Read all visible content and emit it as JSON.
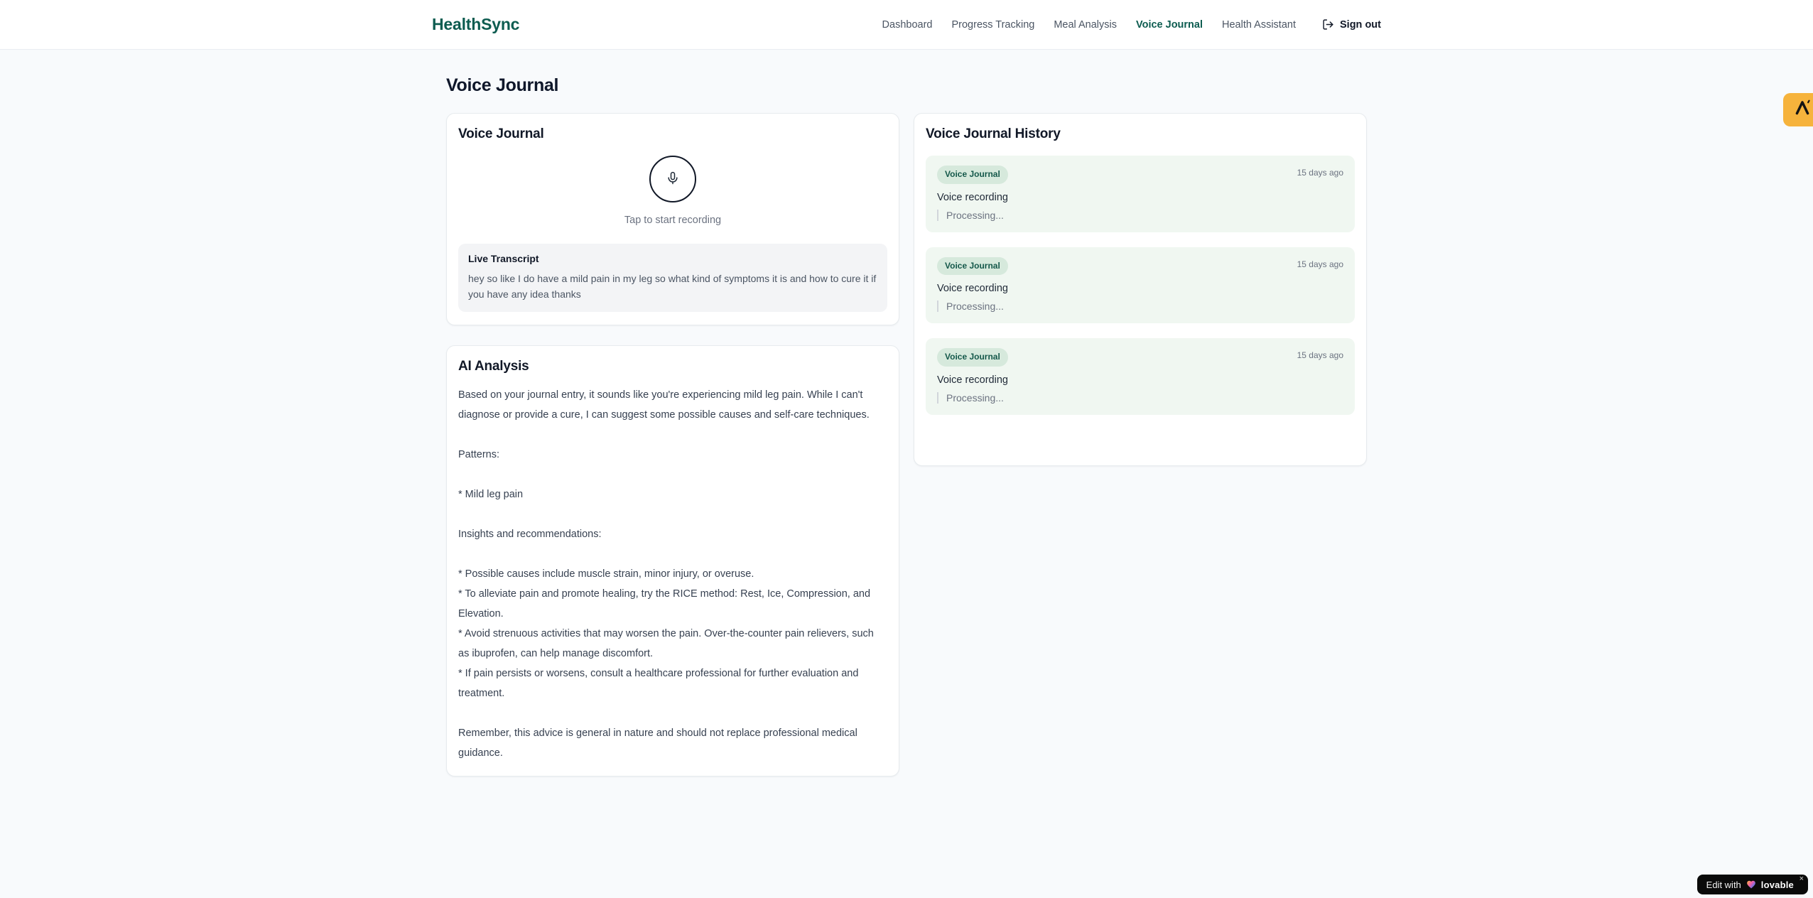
{
  "brand": {
    "name": "HealthSync",
    "color": "#0d5c50"
  },
  "nav": {
    "items": [
      {
        "label": "Dashboard",
        "active": false
      },
      {
        "label": "Progress Tracking",
        "active": false
      },
      {
        "label": "Meal Analysis",
        "active": false
      },
      {
        "label": "Voice Journal",
        "active": true
      },
      {
        "label": "Health Assistant",
        "active": false
      }
    ],
    "signout": {
      "label": "Sign out",
      "icon": "logout-icon"
    }
  },
  "page": {
    "title": "Voice Journal"
  },
  "recorder_card": {
    "title": "Voice Journal",
    "mic_icon": "microphone-icon",
    "tap_hint": "Tap to start recording",
    "transcript": {
      "title": "Live Transcript",
      "text": "hey so like I do have a mild pain in my leg so what kind of symptoms it is and how to cure it if you have any idea thanks"
    }
  },
  "analysis_card": {
    "title": "AI Analysis",
    "body": "Based on your journal entry, it sounds like you're experiencing mild leg pain. While I can't diagnose or provide a cure, I can suggest some possible causes and self-care techniques.\n\nPatterns:\n\n* Mild leg pain\n\nInsights and recommendations:\n\n* Possible causes include muscle strain, minor injury, or overuse.\n* To alleviate pain and promote healing, try the RICE method: Rest, Ice, Compression, and Elevation.\n* Avoid strenuous activities that may worsen the pain. Over-the-counter pain relievers, such as ibuprofen, can help manage discomfort.\n* If pain persists or worsens, consult a healthcare professional for further evaluation and treatment.\n\nRemember, this advice is general in nature and should not replace professional medical guidance."
  },
  "history_card": {
    "title": "Voice Journal History",
    "entries": [
      {
        "badge": "Voice Journal",
        "time": "15 days ago",
        "title": "Voice recording",
        "status": "Processing..."
      },
      {
        "badge": "Voice Journal",
        "time": "15 days ago",
        "title": "Voice recording",
        "status": "Processing..."
      },
      {
        "badge": "Voice Journal",
        "time": "15 days ago",
        "title": "Voice recording",
        "status": "Processing..."
      }
    ]
  },
  "overlays": {
    "lovable": {
      "prefix": "Edit with",
      "brand": "lovable",
      "close": "×",
      "heart_icon": "heart-icon",
      "bg": "#0a0a0a"
    },
    "side_badge": {
      "icon": "lambda-icon",
      "bg": "#f6b33c"
    }
  },
  "colors": {
    "page_bg": "#f8fafc",
    "accent_teal": "#0d5c50",
    "entry_bg": "#f0f7f1",
    "badge_bg": "#d6e9dc",
    "badge_text": "#14584a",
    "muted_text": "#6b7280",
    "body_text": "#374151",
    "transcript_bg": "#f3f4f6"
  }
}
